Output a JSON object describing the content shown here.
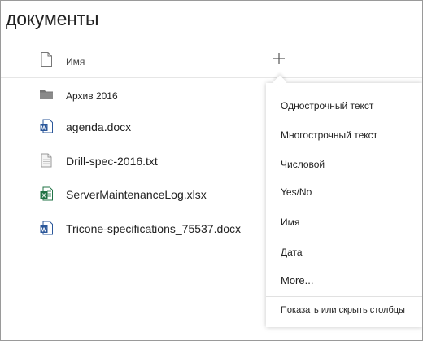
{
  "library": {
    "title": "документы",
    "column_name_label": "Имя"
  },
  "files": [
    {
      "name": "Архив 2016",
      "type": "folder-icon"
    },
    {
      "name": "agenda.docx",
      "type": "word-icon"
    },
    {
      "name": "Drill-spec-2016.txt",
      "type": "text-file-icon"
    },
    {
      "name": "ServerMaintenanceLog.xlsx",
      "type": "excel-icon"
    },
    {
      "name": "Tricone-specifications_75537.docx",
      "type": "word-icon"
    }
  ],
  "column_menu": {
    "items": [
      "Однострочный текст",
      "Многострочный текст",
      "Числовой",
      "Yes/No",
      "Имя",
      "Дата",
      "More..."
    ],
    "footer": "Показать или скрыть столбцы"
  },
  "colors": {
    "word_blue": "#2b579a",
    "excel_green": "#217346",
    "folder_gray": "#767676",
    "menu_shadow": "#cccccc"
  }
}
